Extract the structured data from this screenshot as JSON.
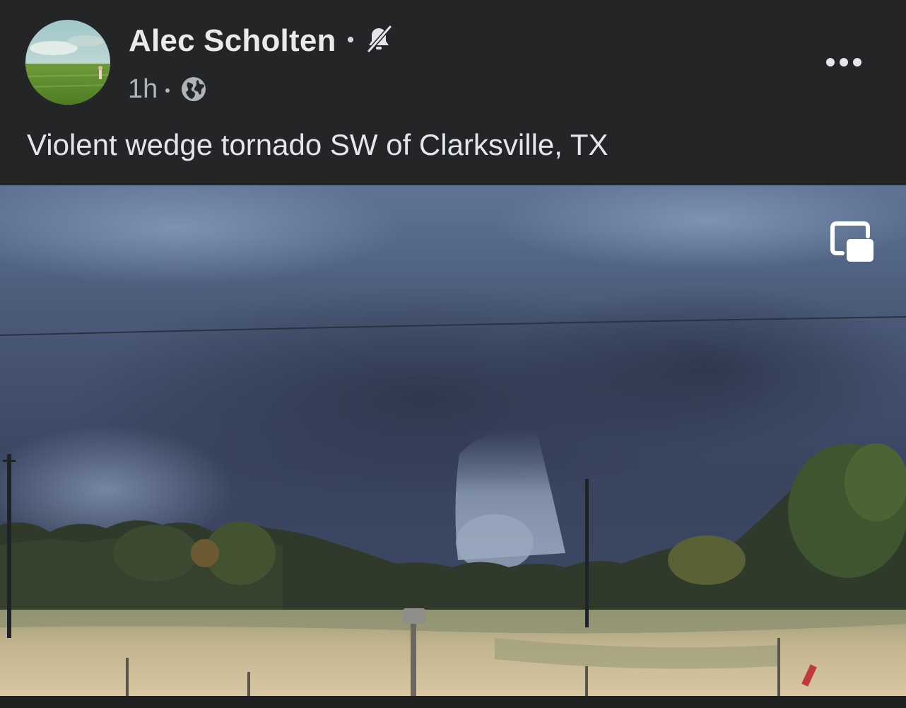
{
  "post": {
    "author_name": "Alec Scholten",
    "timestamp": "1h",
    "caption": "Violent wedge tornado SW of Clarksville, TX"
  },
  "icons": {
    "avatar": "avatar-photo",
    "muted": "bell-slash-icon",
    "privacy": "globe-icon",
    "more": "more-horizontal-icon",
    "pip": "picture-in-picture-icon"
  },
  "colors": {
    "background": "#242526",
    "text_primary": "#e4e6eb",
    "text_secondary": "#b0b3b8"
  }
}
